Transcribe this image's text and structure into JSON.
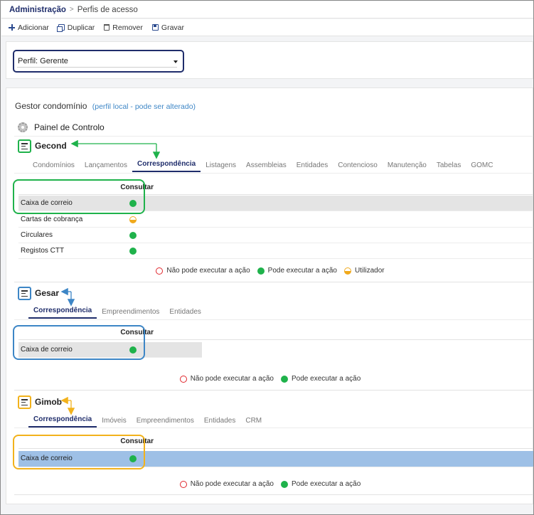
{
  "breadcrumb": {
    "root": "Administração",
    "separator": ">",
    "page": "Perfis de acesso"
  },
  "toolbar": {
    "add_label": "Adicionar",
    "duplicate_label": "Duplicar",
    "remove_label": "Remover",
    "save_label": "Gravar"
  },
  "profile": {
    "label": "Perfil: Gerente"
  },
  "gestor": {
    "title": "Gestor condomínio",
    "note": "(perfil local - pode ser alterado)"
  },
  "painel": {
    "label": "Painel de Controlo"
  },
  "legend": {
    "no": "Não pode executar a ação",
    "yes": "Pode executar a ação",
    "user": "Utilizador"
  },
  "modules": {
    "gecond": {
      "name": "Gecond",
      "tabs": [
        "Condomínios",
        "Lançamentos",
        "Correspondência",
        "Listagens",
        "Assembleias",
        "Entidades",
        "Contencioso",
        "Manutenção",
        "Tabelas",
        "GOMC"
      ],
      "active_tab": "Correspondência",
      "column": "Consultar",
      "rows": [
        {
          "label": "Caixa de correio",
          "status": "yes"
        },
        {
          "label": "Cartas de cobrança",
          "status": "user"
        },
        {
          "label": "Circulares",
          "status": "yes"
        },
        {
          "label": "Registos CTT",
          "status": "yes"
        }
      ]
    },
    "gesar": {
      "name": "Gesar",
      "tabs": [
        "Correspondência",
        "Empreendimentos",
        "Entidades"
      ],
      "active_tab": "Correspondência",
      "column": "Consultar",
      "rows": [
        {
          "label": "Caixa de correio",
          "status": "yes"
        }
      ]
    },
    "gimob": {
      "name": "Gimob",
      "tabs": [
        "Correspondência",
        "Imóveis",
        "Empreendimentos",
        "Entidades",
        "CRM"
      ],
      "active_tab": "Correspondência",
      "column": "Consultar",
      "rows": [
        {
          "label": "Caixa de correio",
          "status": "yes"
        }
      ]
    }
  },
  "colors": {
    "brand": "#1f2d6b",
    "green_highlight": "#1fb24b",
    "blue_highlight": "#3d86c6",
    "yellow_highlight": "#f2b21c",
    "allowed": "#1fb24b",
    "denied": "#e0262c",
    "user": "#f0a91c"
  }
}
